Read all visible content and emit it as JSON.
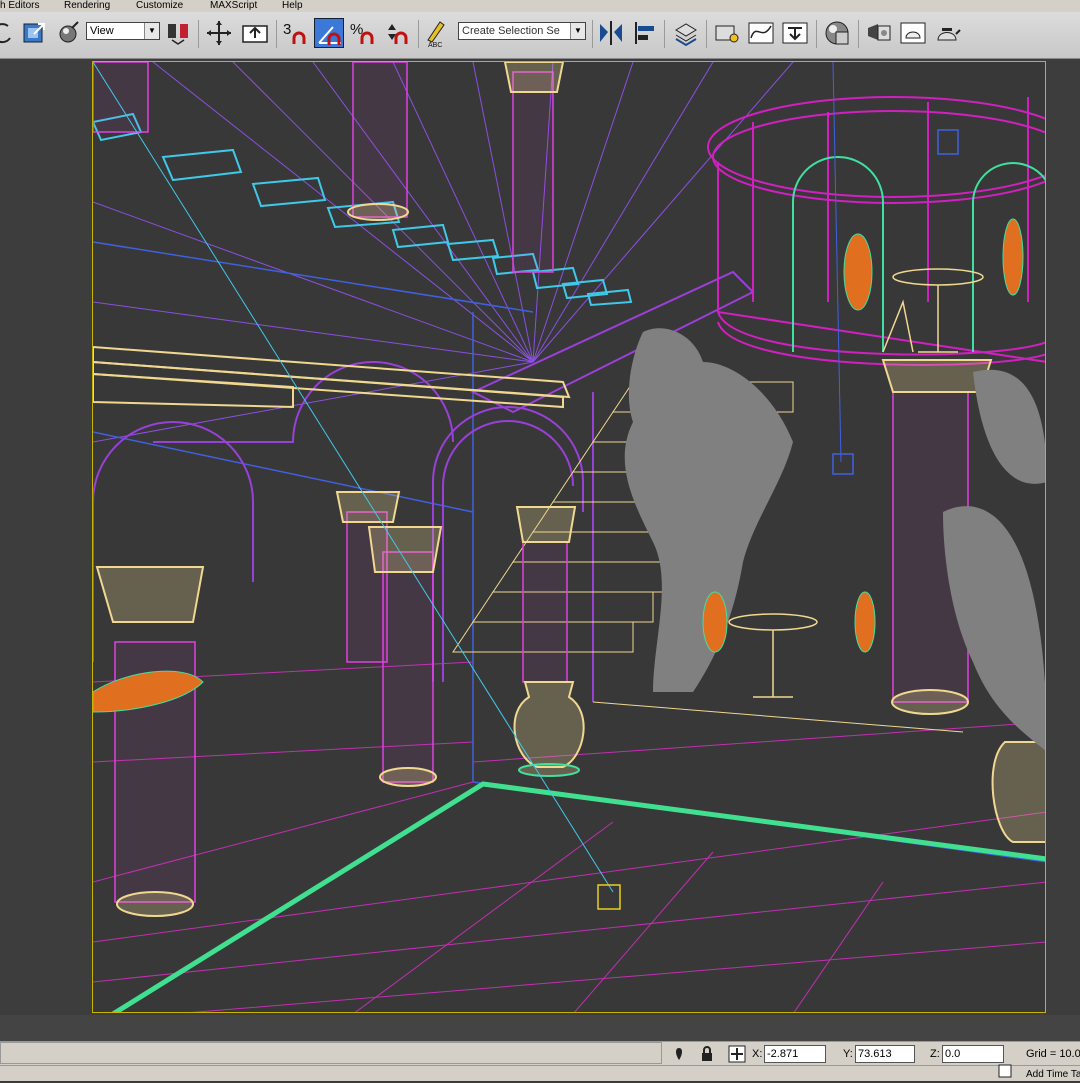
{
  "menu": {
    "items": [
      "h Editors",
      "Rendering",
      "Customize",
      "MAXScript",
      "Help"
    ]
  },
  "toolbar": {
    "reference_coord_value": "View",
    "snap_2d_label": "3",
    "angle_snap_label": "⦞",
    "percent_snap_label": "%",
    "named_selection_placeholder": "Create Selection Se"
  },
  "viewport": {
    "active_border_color": "#c8b400",
    "background_color": "#383838",
    "colors": {
      "columns": "#e040e0",
      "capitals": "#f0d890",
      "stairs_upper": "#40c8e8",
      "arches": "#9840d8",
      "balcony": "#d020c0",
      "railing": "#40e0a0",
      "chairs": "#e07020",
      "plants": "#808080",
      "floor_edge": "#40e090",
      "grid": "#c030b0"
    }
  },
  "status": {
    "x_label": "X:",
    "x_value": "-2.871",
    "y_label": "Y:",
    "y_value": "73.613",
    "z_label": "Z:",
    "z_value": "0.0",
    "grid_label": "Grid = 10.0",
    "add_time_tag": "Add Time Tag"
  },
  "icons": [
    "undo-icon",
    "select-and-scale-icon",
    "select-manipulate-icon",
    "reference-coord-dropdown",
    "use-pivot-center-icon",
    "select-and-move-icon",
    "keyboard-shortcut-override-icon",
    "snap-toggle-icon",
    "angle-snap-icon",
    "percent-snap-icon",
    "spinner-snap-icon",
    "edit-named-selection-icon",
    "mirror-icon",
    "align-icon",
    "layer-manager-icon",
    "graphite-tools-icon",
    "curve-editor-icon",
    "schematic-view-icon",
    "material-editor-icon",
    "render-setup-icon",
    "rendered-frame-window-icon",
    "render-production-icon",
    "lock-selection-icon",
    "absolute-mode-icon"
  ]
}
